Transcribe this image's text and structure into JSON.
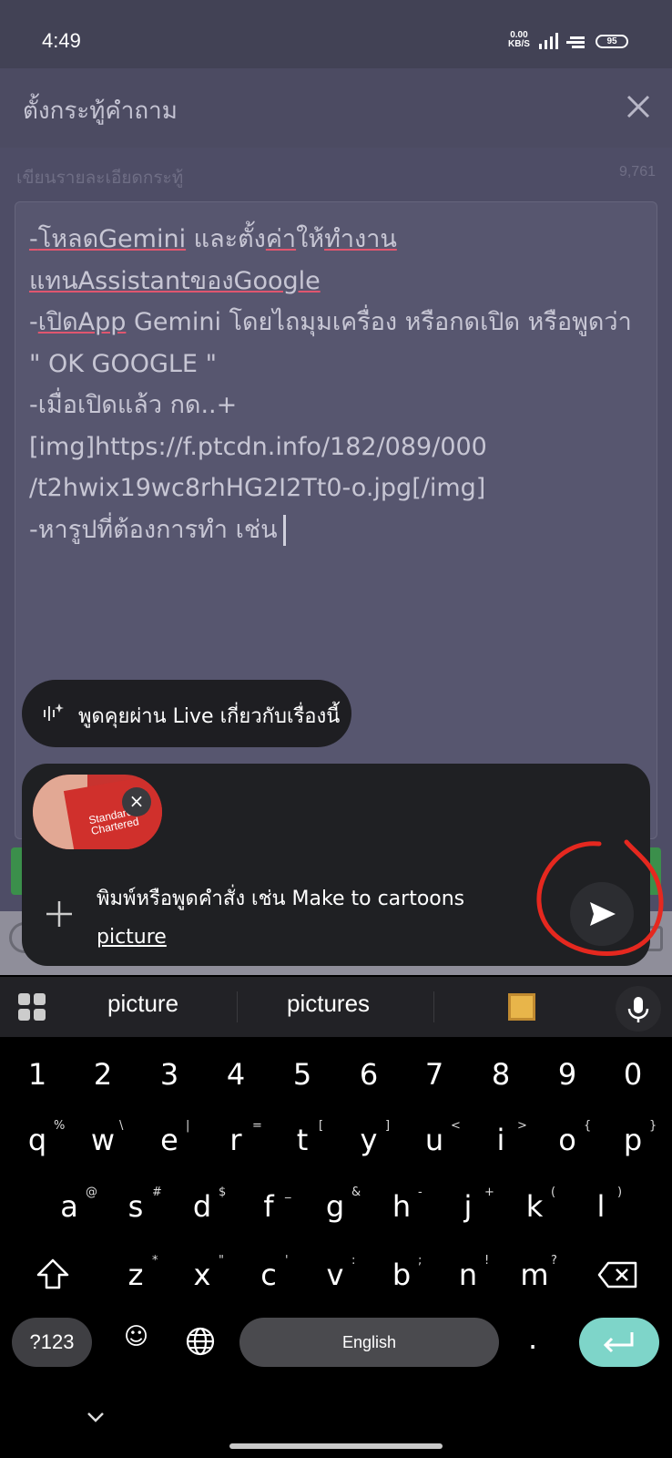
{
  "status": {
    "time": "4:49",
    "net_speed": "0.00",
    "net_unit": "KB/S",
    "battery": "95"
  },
  "header": {
    "title": "ตั้งกระทู้คำถาม"
  },
  "form": {
    "desc_label": "เขียนรายละเอียดกระทู้",
    "char_count": "9,761",
    "body_lines": [
      "-โหลดGemini และตั้งค่าให้ทำงาน",
      "แทนAssistantของGoogle",
      "-เปิดApp Gemini โดยไถมุมเครื่อง หรือกดเปิด หรือพูดว่า",
      "\" OK GOOGLE \"",
      "-เมื่อเปิดแล้ว กด..+",
      "[img]https://f.ptcdn.info/182/089/000",
      "/t2hwix19wc8rhHG2I2Tt0-o.jpg[/img]",
      "-หารูปที่ต้องการทำ เช่น"
    ]
  },
  "gemini": {
    "live_label": "พูดคุยผ่าน Live เกี่ยวกับเรื่องนี้",
    "thumb_text": "Standard Chartered",
    "prompt_text": "พิมพ์หรือพูดคำสั่ง เช่น Make to cartoons",
    "prompt_word": "picture"
  },
  "suggestions": [
    "picture",
    "pictures"
  ],
  "keyboard": {
    "numbers": [
      "1",
      "2",
      "3",
      "4",
      "5",
      "6",
      "7",
      "8",
      "9",
      "0"
    ],
    "row1": [
      "q",
      "w",
      "e",
      "r",
      "t",
      "y",
      "u",
      "i",
      "o",
      "p"
    ],
    "row1_sup": [
      "%",
      "\\",
      "|",
      "=",
      "[",
      "]",
      "<",
      ">",
      "{",
      "}"
    ],
    "row2": [
      "a",
      "s",
      "d",
      "f",
      "g",
      "h",
      "j",
      "k",
      "l"
    ],
    "row2_sup": [
      "@",
      "#",
      "$",
      "_",
      "&",
      "-",
      "+",
      "(",
      ")"
    ],
    "row3": [
      "z",
      "x",
      "c",
      "v",
      "b",
      "n",
      "m"
    ],
    "row3_sup": [
      "*",
      "\"",
      "'",
      ":",
      ";",
      "!",
      "?"
    ],
    "symbols_label": "?123",
    "space_label": "English",
    "period": "."
  },
  "colors": {
    "annotation": "#e5281f",
    "enter_key": "#7ed5c9",
    "title_bar": "#4c4b62"
  }
}
